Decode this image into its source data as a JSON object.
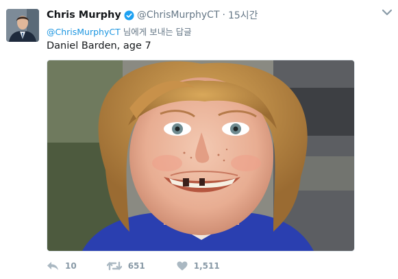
{
  "tweet": {
    "author_name": "Chris Murphy",
    "author_handle": "@ChrisMurphyCT",
    "separator": "·",
    "timestamp": "15시간",
    "reply_to_handle": "@ChrisMurphyCT",
    "reply_to_suffix": " 님에게 보내는 답글",
    "text": "Daniel Barden, age 7",
    "avatar": "profile-photo-man-in-suit",
    "image": "photo-smiling-boy-with-curly-hair",
    "verified": true
  },
  "actions": {
    "reply": {
      "icon": "reply-icon",
      "count": "10"
    },
    "retweet": {
      "icon": "retweet-icon",
      "count": "651"
    },
    "like": {
      "icon": "heart-icon",
      "count": "1,511"
    }
  },
  "colors": {
    "text": "#14171a",
    "muted": "#657786",
    "link": "#1b95e0",
    "verified": "#1da1f2",
    "action_icon": "#aab8c2"
  }
}
